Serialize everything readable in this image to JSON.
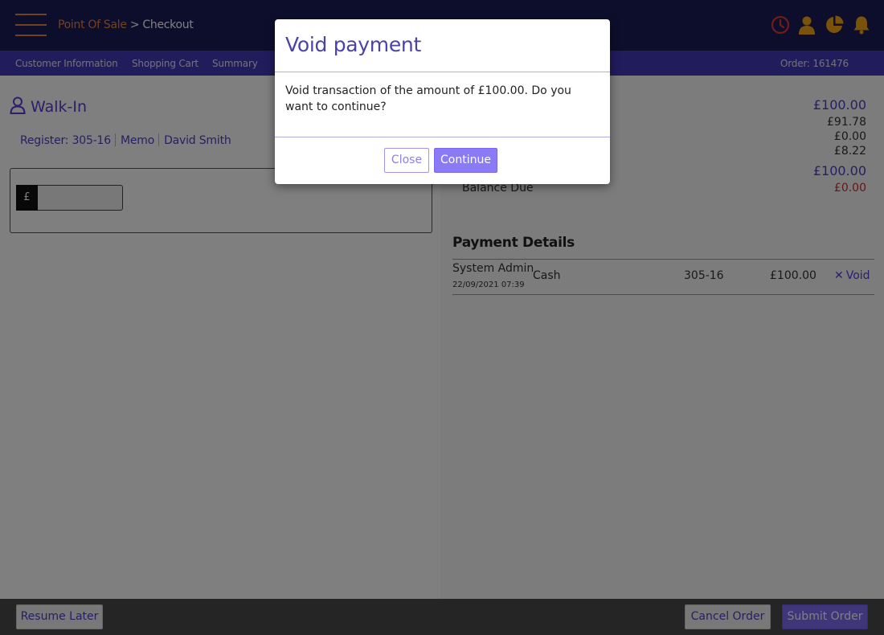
{
  "header": {
    "breadcrumb_root": "Point Of Sale",
    "breadcrumb_sep": " > ",
    "breadcrumb_current": "Checkout",
    "icons": [
      "clock-icon",
      "user-icon",
      "pie-chart-icon",
      "bell-icon"
    ],
    "colors": {
      "bar": "#1b1d59",
      "accent": "#e8833a",
      "alert": "#e03b2e",
      "icon": "#f2a516"
    }
  },
  "subnav": {
    "tabs": [
      "Customer Information",
      "Shopping Cart",
      "Summary"
    ],
    "order_label": "Order: 161476"
  },
  "customer": {
    "name": "Walk-In",
    "register_label": "Register:",
    "register_value": "305-16",
    "memo": "Memo",
    "salesperson": "David Smith"
  },
  "payment_input": {
    "currency_symbol": "£",
    "value": ""
  },
  "totals": {
    "total": "£100.00",
    "line1": "£91.78",
    "line2": "£0.00",
    "line3": "£8.22",
    "paid": "£100.00",
    "balance_label": "Balance Due",
    "balance_value": "£0.00"
  },
  "payment_details": {
    "title": "Payment Details",
    "rows": [
      {
        "user": "System Admin",
        "date": "22/09/2021 07:39",
        "method": "Cash",
        "register": "305-16",
        "amount": "£100.00",
        "action": "Void"
      }
    ]
  },
  "footer": {
    "resume_later": "Resume Later",
    "cancel_order": "Cancel Order",
    "submit_order": "Submit Order"
  },
  "modal": {
    "title": "Void payment",
    "message": "Void transaction of the amount of £100.00. Do you want to continue?",
    "close_label": "Close",
    "continue_label": "Continue"
  }
}
